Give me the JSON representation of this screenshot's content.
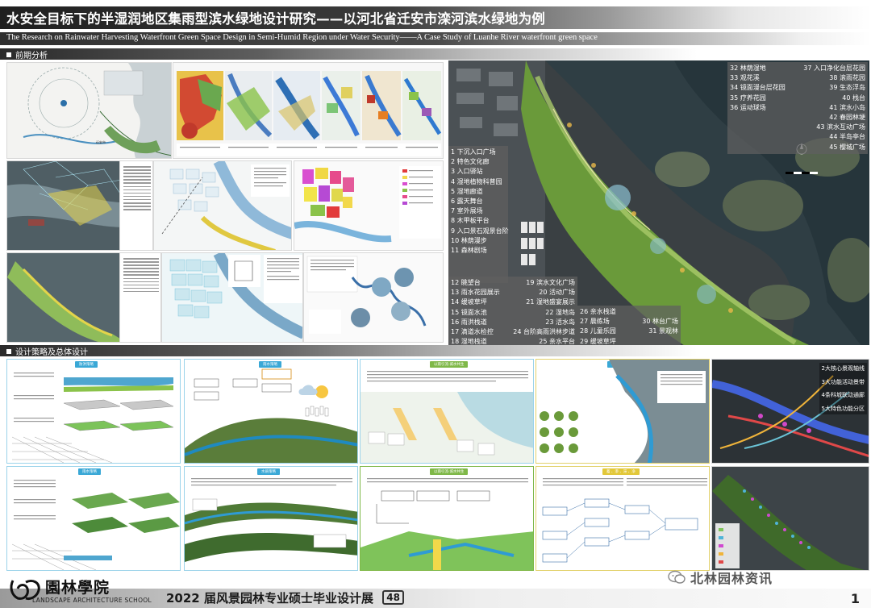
{
  "header": {
    "title_cn": "水安全目标下的半湿润地区集雨型滨水绿地设计研究——以河北省迁安市滦河滨水绿地为例",
    "title_en": "The Research on Rainwater Harvesting Waterfront Green Space Design in Semi-Humid Region under Water Security——A Case Study of Luanhe River waterfront green space"
  },
  "sections": {
    "analysis": "前期分析",
    "strategy": "设计策略及总体设计"
  },
  "site_plan_legend": {
    "left_column": [
      "1 下沉入口广场",
      "2 特色文化廊",
      "3 入口驿站",
      "4 湿地植物科普园",
      "5 湿地廊道",
      "6 露天舞台",
      "7 室外展场",
      "8 木甲板平台",
      "9 入口景石观景台阶",
      "10 林荫漫步",
      "11 森林剧场"
    ],
    "middle_pairs": [
      [
        "12 眺望台",
        "19 滨水文化广场"
      ],
      [
        "13 雨水花园展示",
        "20 活动广场"
      ],
      [
        "14 缓坡草坪",
        "21 湿地盛宴展示"
      ],
      [
        "15 镜面水池",
        "22 湿地岛"
      ],
      [
        "16 雨洪栈道",
        "23 活水岛"
      ],
      [
        "17 滴道水检控",
        "24 台阶高雨洪林步道"
      ],
      [
        "18 湿地栈道",
        "25 亲水平台"
      ]
    ],
    "bottom_right": [
      [
        "26 亲水栈道",
        ""
      ],
      [
        "27 晨练场",
        "30 林台广场"
      ],
      [
        "28 儿童乐园",
        "31 景观林"
      ],
      [
        "29 缓坡草坪",
        ""
      ]
    ],
    "top_right_pairs": [
      [
        "32 林荫湿地",
        "37 入口净化台层花园"
      ],
      [
        "33 观花溪",
        "38 滚雨花园"
      ],
      [
        "34 镜面漫台层花园",
        "39 生态浮岛"
      ],
      [
        "35 疗养花园",
        "40 栈台"
      ],
      [
        "36 运动球场",
        "41 滨水小岛"
      ],
      [
        "",
        "42 春园林埂"
      ],
      [
        "",
        "43 滨水互动广场"
      ],
      [
        "",
        "44 半岛亭台"
      ],
      [
        "",
        "45 樱城广场"
      ]
    ]
  },
  "strategy_panels": {
    "flood_title": "防洪策略",
    "rain_title": "雨水策略",
    "water_title": "水质策略",
    "ecology_title": "生态策略",
    "eco_step_title": "以雨引流·城水共生",
    "eco_step_title_2": "以雨引流·城水共生",
    "process_title": "蓄 、渗 、滞 、净",
    "sidebar_right": [
      "2大核心景观轴线",
      "3大功能活动景带",
      "4条科城联动通廊",
      "5大特色功能分区"
    ]
  },
  "footer": {
    "school_cn": "園林學院",
    "school_en": "LANDSCAPE ARCHITECTURE SCHOOL",
    "exhibition": "2022 届风景园林专业硕士毕业设计展",
    "exhibit_no": "48",
    "page": "1",
    "watermark": "北林园林资讯"
  },
  "colors": {
    "title_band": "#2a2a2a",
    "water_dark": "#3d4a50",
    "green_plan": "#6c9a3a",
    "accent_blue": "#3aa8d6"
  }
}
